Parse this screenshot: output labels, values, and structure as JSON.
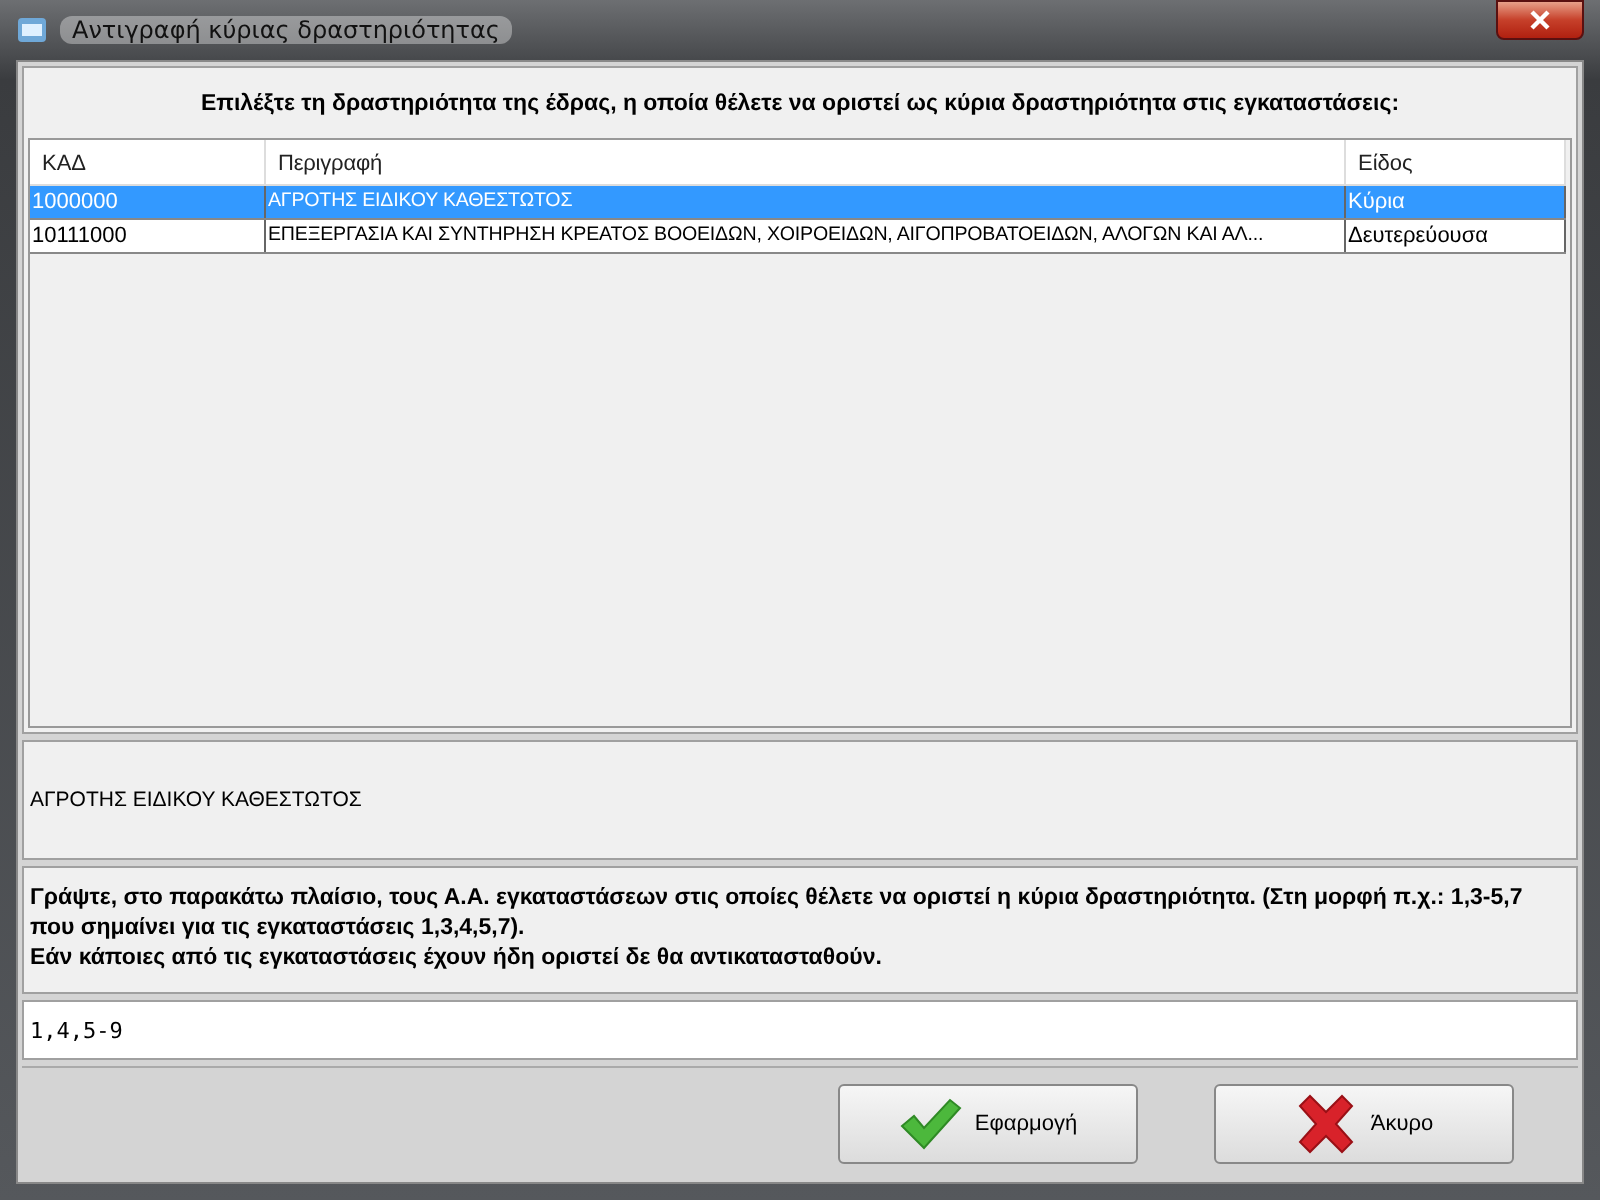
{
  "window": {
    "title": "Αντιγραφή κύριας δραστηριότητας"
  },
  "prompt": "Επιλέξτε τη δραστηριότητα της έδρας, η οποία θέλετε να οριστεί ως κύρια δραστηριότητα στις εγκαταστάσεις:",
  "table": {
    "columns": [
      "ΚΑΔ",
      "Περιγραφή",
      "Είδος"
    ],
    "rows": [
      {
        "cells": [
          "1000000",
          "ΑΓΡΟΤΗΣ ΕΙΔΙΚΟΥ ΚΑΘΕΣΤΩΤΟΣ",
          "Κύρια"
        ],
        "selected": true
      },
      {
        "cells": [
          "10111000",
          "ΕΠΕΞΕΡΓΑΣΙΑ ΚΑΙ ΣΥΝΤΗΡΗΣΗ ΚΡΕΑΤΟΣ ΒΟΟΕΙΔΩΝ, ΧΟΙΡΟΕΙΔΩΝ, ΑΙΓΟΠΡΟΒΑΤΟΕΙΔΩΝ, ΑΛΟΓΩΝ ΚΑΙ ΑΛ...",
          "Δευτερεύουσα"
        ],
        "selected": false
      }
    ]
  },
  "selected_description": "ΑΓΡΟΤΗΣ ΕΙΔΙΚΟΥ ΚΑΘΕΣΤΩΤΟΣ",
  "instructions": [
    "Γράψτε, στο παρακάτω πλαίσιο, τους Α.Α. εγκαταστάσεων στις οποίες θέλετε να οριστεί η κύρια δραστηριότητα. (Στη μορφή π.χ.: 1,3-5,7 που σημαίνει για τις εγκαταστάσεις 1,3,4,5,7).",
    "Εάν κάποιες από τις εγκαταστάσεις έχουν ήδη οριστεί δε θα αντικατασταθούν."
  ],
  "input": {
    "value": "1,4,5-9"
  },
  "buttons": [
    {
      "kind": "apply",
      "label": "Εφαρμογή"
    },
    {
      "kind": "cancel",
      "label": "Άκυρο"
    }
  ]
}
